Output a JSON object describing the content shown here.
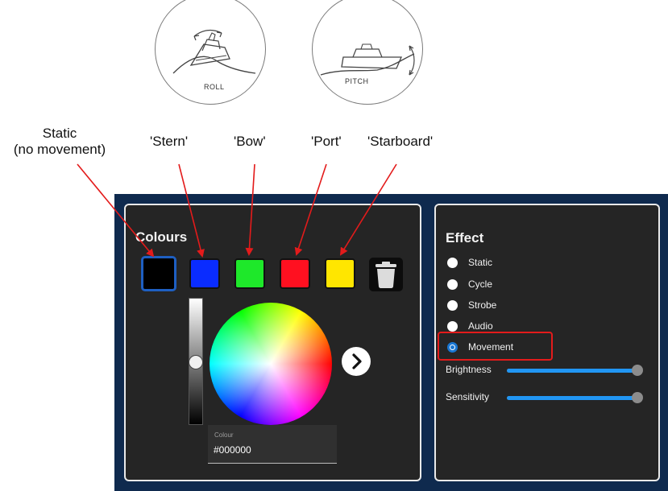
{
  "illustrations": {
    "roll_caption": "ROLL",
    "pitch_caption": "PITCH"
  },
  "annotations": {
    "static_line1": "Static",
    "static_line2": "(no movement)",
    "stern": "'Stern'",
    "bow": "'Bow'",
    "port": "'Port'",
    "starboard": "'Starboard'",
    "arrow_color": "#e31b1b"
  },
  "colours_panel": {
    "title": "Colours",
    "swatches": [
      {
        "color": "#000000",
        "selected": true
      },
      {
        "color": "#0a2cff"
      },
      {
        "color": "#1ee82a"
      },
      {
        "color": "#ff1020"
      },
      {
        "color": "#ffe600"
      }
    ],
    "delete_icon": "trash-icon",
    "brightness_level": 0.5,
    "next_icon": "chevron-right-icon",
    "field_label": "Colour",
    "field_value": "#000000"
  },
  "effect_panel": {
    "title": "Effect",
    "options": [
      "Static",
      "Cycle",
      "Strobe",
      "Audio",
      "Movement"
    ],
    "selected": "Movement",
    "brightness_label": "Brightness",
    "brightness_value": 1.0,
    "sensitivity_label": "Sensitivity",
    "sensitivity_value": 1.0,
    "accent": "#2196f3"
  }
}
